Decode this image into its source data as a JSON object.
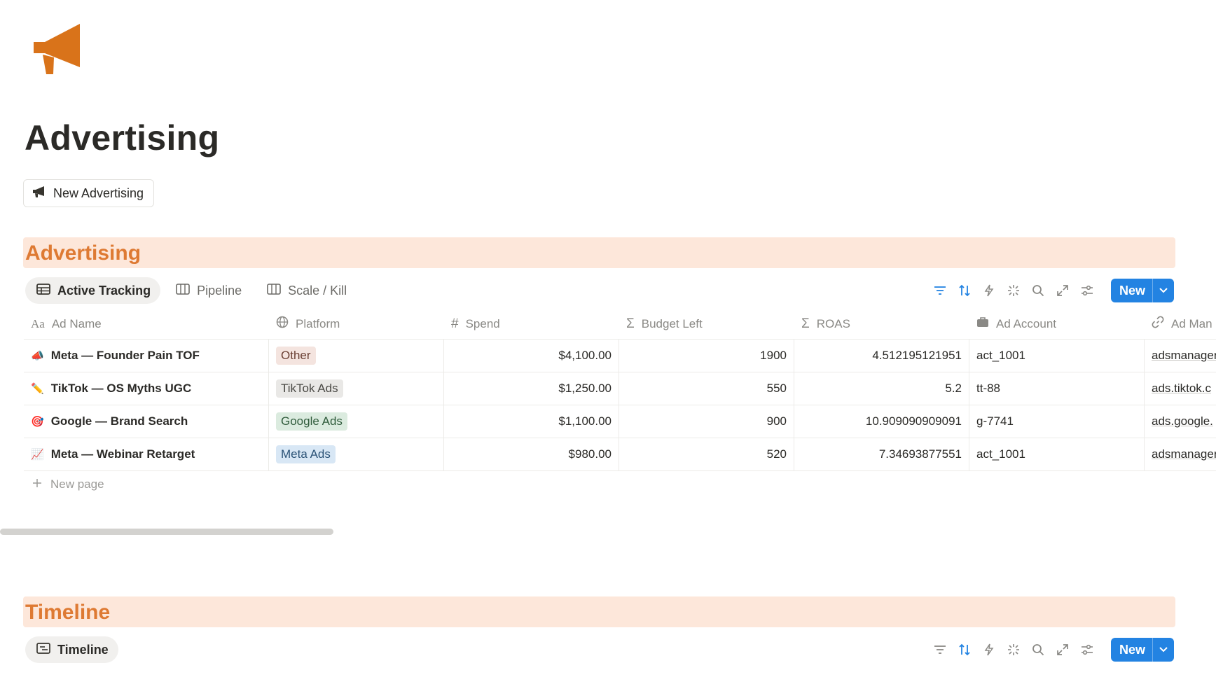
{
  "page": {
    "title": "Advertising"
  },
  "new_button": {
    "label": "New Advertising"
  },
  "sections": [
    {
      "heading": "Advertising",
      "views": [
        {
          "label": "Active Tracking",
          "icon": "table-icon",
          "active": true
        },
        {
          "label": "Pipeline",
          "icon": "board-icon",
          "active": false
        },
        {
          "label": "Scale / Kill",
          "icon": "board-icon",
          "active": false
        }
      ],
      "new_label": "New"
    },
    {
      "heading": "Timeline",
      "views": [
        {
          "label": "Timeline",
          "icon": "timeline-icon",
          "active": true
        }
      ],
      "new_label": "New"
    }
  ],
  "table": {
    "columns": [
      {
        "label": "Ad Name",
        "icon": "text-aa-icon"
      },
      {
        "label": "Platform",
        "icon": "globe-icon"
      },
      {
        "label": "Spend",
        "icon": "hash-icon"
      },
      {
        "label": "Budget Left",
        "icon": "sigma-icon"
      },
      {
        "label": "ROAS",
        "icon": "sigma-icon"
      },
      {
        "label": "Ad Account",
        "icon": "briefcase-icon"
      },
      {
        "label": "Ad Man",
        "icon": "link-icon"
      }
    ],
    "rows": [
      {
        "emoji": "📣",
        "name": "Meta — Founder Pain TOF",
        "platform": "Other",
        "platform_bg": "#f4e4df",
        "platform_fg": "#6b4034",
        "spend": "$4,100.00",
        "budget_left": "1900",
        "roas": "4.512195121951",
        "account": "act_1001",
        "manager": "adsmanager"
      },
      {
        "emoji": "✏️",
        "name": "TikTok — OS Myths UGC",
        "platform": "TikTok Ads",
        "platform_bg": "#e9e8e6",
        "platform_fg": "#4a4945",
        "spend": "$1,250.00",
        "budget_left": "550",
        "roas": "5.2",
        "account": "tt-88",
        "manager": "ads.tiktok.c"
      },
      {
        "emoji": "🎯",
        "name": "Google — Brand Search",
        "platform": "Google Ads",
        "platform_bg": "#dbebdf",
        "platform_fg": "#2f5b3b",
        "spend": "$1,100.00",
        "budget_left": "900",
        "roas": "10.909090909091",
        "account": "g-7741",
        "manager": "ads.google."
      },
      {
        "emoji": "📈",
        "name": "Meta — Webinar Retarget",
        "platform": "Meta Ads",
        "platform_bg": "#d8e7f5",
        "platform_fg": "#2b5377",
        "spend": "$980.00",
        "budget_left": "520",
        "roas": "7.34693877551",
        "account": "act_1001",
        "manager": "adsmanager"
      }
    ],
    "new_page_label": "New page"
  },
  "colors": {
    "accent": "#2383e2",
    "heading": "#de7a33",
    "heading_bg": "#fde7da",
    "icon_orange": "#d9731a"
  }
}
